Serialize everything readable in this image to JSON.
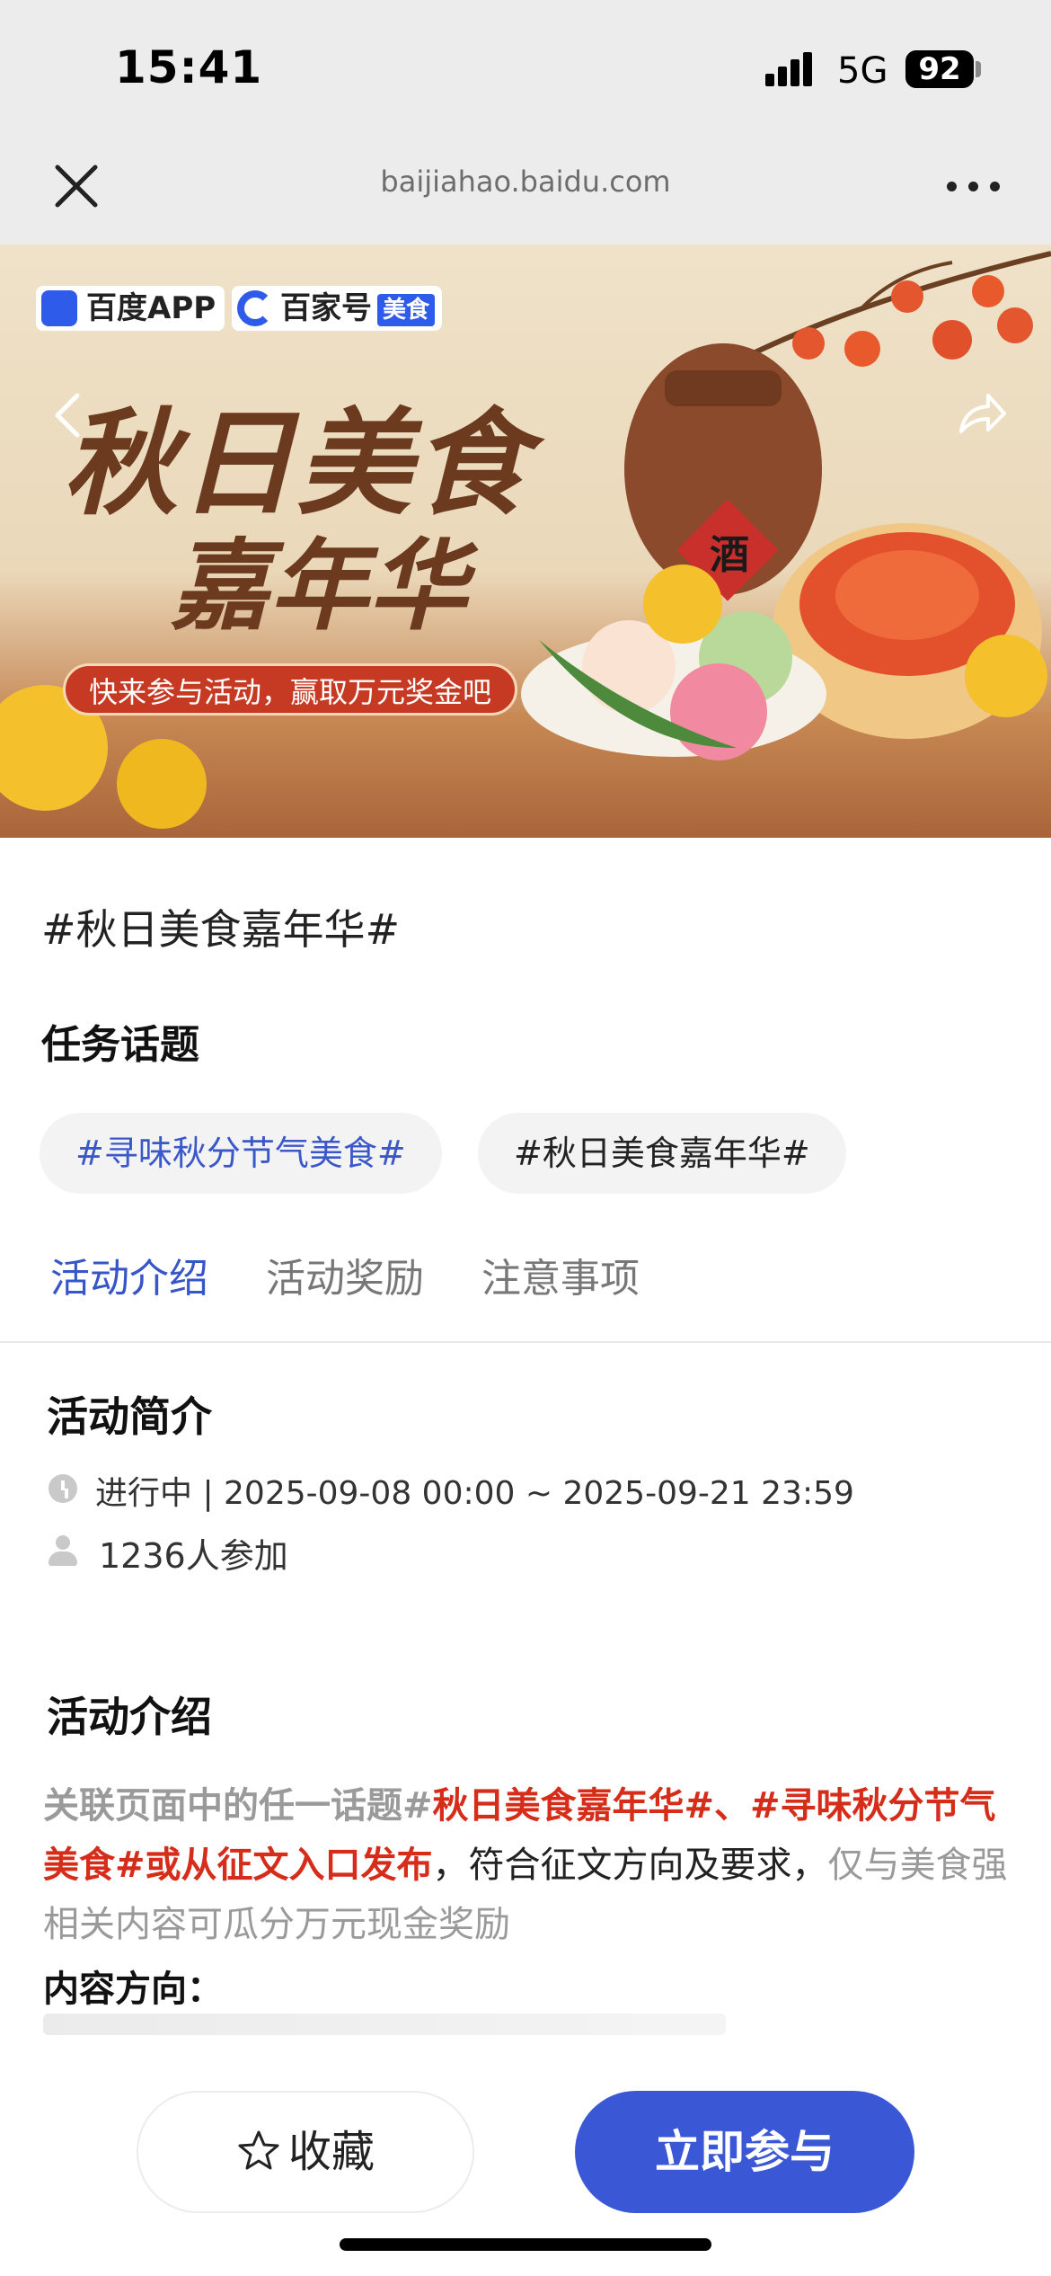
{
  "status_bar": {
    "time": "15:41",
    "network": "5G",
    "battery": "92"
  },
  "browser": {
    "url": "baijiahao.baidu.com"
  },
  "banner": {
    "logo_baidu": "百度APP",
    "logo_bjh": "百家号",
    "logo_tag": "美食",
    "title_line1": "秋日美食",
    "title_line2": "嘉年华",
    "slogan": "快来参与活动，赢取万元奖金吧",
    "jar_label": "酒"
  },
  "page": {
    "title": "#秋日美食嘉年华#",
    "task_section": "任务话题",
    "topics": [
      "#寻味秋分节气美食#",
      "#秋日美食嘉年华#"
    ],
    "tabs": [
      "活动介绍",
      "活动奖励",
      "注意事项"
    ],
    "active_tab": "活动介绍"
  },
  "summary": {
    "heading": "活动简介",
    "status_text": "进行中 | 2025-09-08 00:00 ~ 2025-09-21 23:59",
    "participants": "1236人参加"
  },
  "intro": {
    "heading": "活动介绍",
    "part1": "关联页面中的任一话题#",
    "part2": "秋日美食嘉年华#、#寻味秋分节气美食#或从征文入口发布",
    "part3": "，符合征文方向及要求，",
    "part4": "仅与美食强相关内容可瓜分万元现金奖励",
    "content_direction": "内容方向："
  },
  "bottom": {
    "favorite_label": "收藏",
    "join_label": "立即参与"
  },
  "colors": {
    "accent": "#3a57d6",
    "highlight_red": "#d62c1a",
    "banner_brown": "#6b3a1f"
  }
}
